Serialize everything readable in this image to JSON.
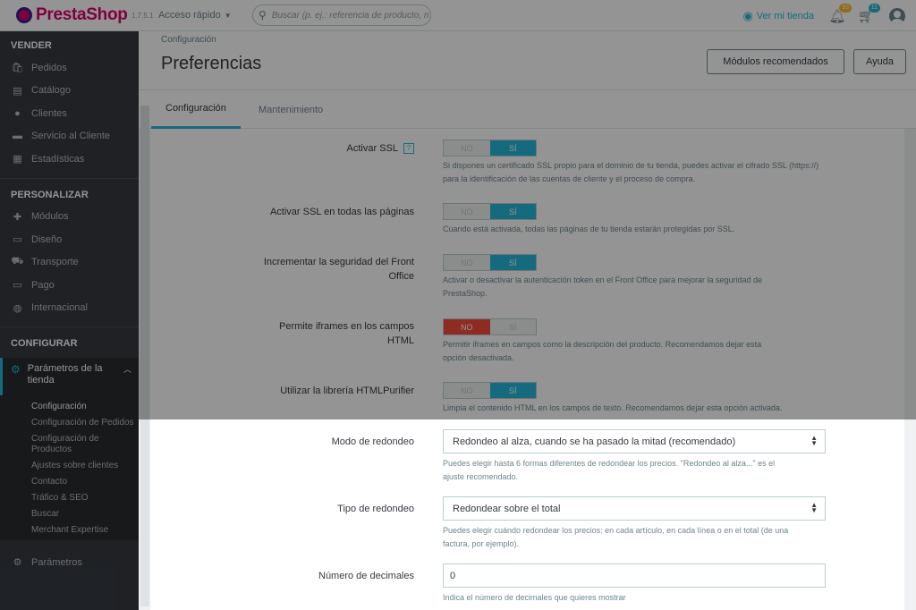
{
  "header": {
    "logo_text": "PrestaShop",
    "version": "1.7.5.1",
    "quick_access": "Acceso rápido",
    "search_placeholder": "Buscar (p. ej.: referencia de producto, n",
    "view_store": "Ver mi tienda",
    "notif_count": "93",
    "orders_count": "11"
  },
  "sidebar": {
    "sell_title": "VENDER",
    "sell_items": [
      "Pedidos",
      "Catálogo",
      "Clientes",
      "Servicio al Cliente",
      "Estadísticas"
    ],
    "customize_title": "PERSONALIZAR",
    "customize_items": [
      "Módulos",
      "Diseño",
      "Transporte",
      "Pago",
      "Internacional"
    ],
    "configure_title": "CONFIGURAR",
    "active_item": "Parámetros de la tienda",
    "sub_items": [
      "Configuración",
      "Configuración de Pedidos",
      "Configuración de Productos",
      "Ajustes sobre clientes",
      "Contacto",
      "Tráfico & SEO",
      "Buscar",
      "Merchant Expertise"
    ],
    "last_item": "Parámetros"
  },
  "page": {
    "breadcrumb": "Configuración",
    "title": "Preferencias",
    "btn_modules": "Módulos recomendados",
    "btn_help": "Ayuda"
  },
  "tabs": [
    "Configuración",
    "Mantenimiento"
  ],
  "settings": {
    "ssl": {
      "label": "Activar SSL",
      "help_icon": "?",
      "no": "NO",
      "yes": "SÍ",
      "help": "Si dispones un certificado SSL propio para el dominio de tu tienda, puedes activar el cifrado SSL (https://) para la identificación de las cuentas de cliente y el proceso de compra."
    },
    "ssl_all": {
      "label": "Activar SSL en todas las páginas",
      "no": "NO",
      "yes": "SÍ",
      "help": "Cuando está activada, todas las páginas de tu tienda estarán protegidas por SSL."
    },
    "front_sec": {
      "label1": "Incrementar la seguridad del Front",
      "label2": "Office",
      "no": "NO",
      "yes": "SÍ",
      "help1": "Activar o desactivar la autenticación token en el Front Office para mejorar la seguridad de",
      "help2": "PrestaShop."
    },
    "iframes": {
      "label1": "Permite iframes en los campos",
      "label2": "HTML",
      "no": "NO",
      "yes": "SÍ",
      "help1": "Permitir iframes en campos como la descripción del producto. Recomendamos dejar esta",
      "help2": "opción desactivada."
    },
    "purifier": {
      "label": "Utilizar la librería HTMLPurifier",
      "no": "NO",
      "yes": "SÍ",
      "help": "Limpia el contenido HTML en los campos de texto. Recomendamos dejar esta opción activada."
    },
    "round_mode": {
      "label": "Modo de redondeo",
      "value": "Redondeo al alza, cuando se ha pasado la mitad (recomendado)",
      "help1": "Puedes elegir hasta 6 formas diferentes de redondear los precios. \"Redondeo al alza...\" es el",
      "help2": "ajuste recomendado."
    },
    "round_type": {
      "label": "Tipo de redondeo",
      "value": "Redondear sobre el total",
      "help1": "Puedes elegir cuándo redondear los precios: en cada artículo, en cada línea o en el total (de una",
      "help2": "factura, por ejemplo)."
    },
    "decimals": {
      "label": "Número de decimales",
      "value": "0",
      "help": "Indica el número de decimales que quieres mostrar"
    }
  }
}
